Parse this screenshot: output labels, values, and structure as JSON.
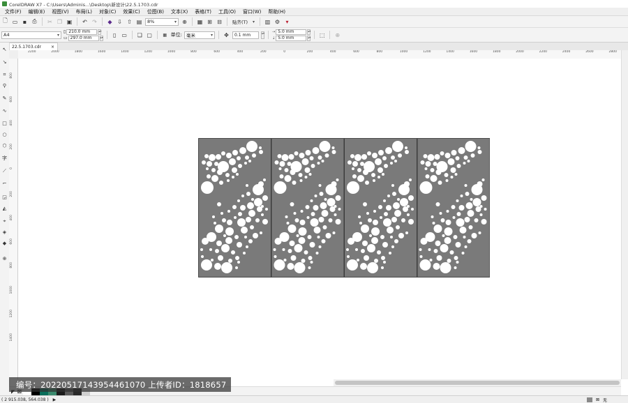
{
  "window": {
    "title": "CorelDRAW X7 - C:\\Users\\Adminis...\\Desktop\\新设计\\22.5.1703.cdr"
  },
  "menu": [
    "文件(F)",
    "编辑(E)",
    "视图(V)",
    "布局(L)",
    "对象(C)",
    "效果(C)",
    "位图(B)",
    "文本(X)",
    "表格(T)",
    "工具(O)",
    "窗口(W)",
    "帮助(H)"
  ],
  "toolbar": {
    "zoom_value": "8%",
    "snap_label": "贴齐(T)"
  },
  "property_bar": {
    "page_size": "A4",
    "width": "210.0 mm",
    "height": "297.0 mm",
    "units_label": "单位:",
    "units_value": "毫米",
    "nudge": "0.1 mm",
    "dup_x": "5.0 mm",
    "dup_y": "5.0 mm"
  },
  "document_tab": {
    "label": "22.5.1703.cdr",
    "close": "×"
  },
  "ruler": {
    "h_labels": [
      "2200",
      "2000",
      "1800",
      "1600",
      "1400",
      "1200",
      "1000",
      "800",
      "600",
      "400",
      "200",
      "0",
      "200",
      "400",
      "600",
      "800",
      "1000",
      "1200",
      "1400",
      "1600",
      "1800",
      "2000",
      "2200",
      "2400",
      "2600",
      "2800"
    ],
    "v_labels": [
      "800",
      "600",
      "400",
      "200",
      "0",
      "200",
      "400",
      "600",
      "800",
      "1000",
      "1200",
      "1400"
    ]
  },
  "status": {
    "coordinates": "( 2 915.038, 564.038 )",
    "fill_label": "无"
  },
  "watermark": {
    "text": "编号：20220517143954461070 上传者ID：1818657"
  },
  "colors": {
    "panel_fill": "#7a7a7a",
    "hole_fill": "#ffffff",
    "chrome": "#f3f3f3",
    "palette": [
      "#ffffff",
      "#000000",
      "#0a6e5a",
      "#3b8a6e",
      "#1b1b1b",
      "#5a5a5a",
      "#2a2a2a",
      "#d0d0d0"
    ]
  }
}
